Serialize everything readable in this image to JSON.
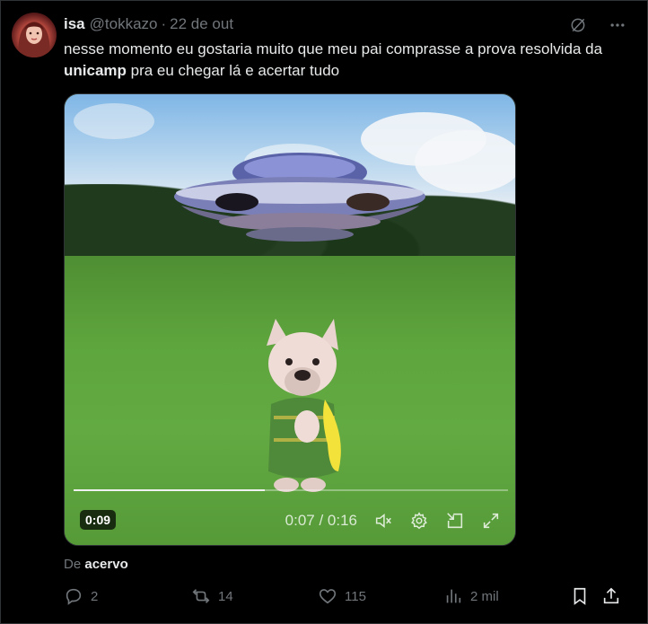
{
  "tweet": {
    "author_name": "isa",
    "handle": "@tokkazo",
    "separator": "·",
    "date": "22 de out",
    "text_before": "nesse momento eu gostaria muito que meu pai comprasse a prova resolvida da ",
    "text_bold": "unicamp",
    "text_after": " pra eu chegar lá e acertar tudo"
  },
  "video": {
    "remaining_badge": "0:09",
    "time_display": "0:07 / 0:16",
    "progress": 0.44
  },
  "source": {
    "prefix": "De",
    "name": "acervo"
  },
  "actions": {
    "replies": "2",
    "retweets": "14",
    "likes": "115",
    "views": "2 mil"
  },
  "icons": {
    "grok": "grok-icon",
    "more": "more-icon",
    "reply": "reply-icon",
    "retweet": "retweet-icon",
    "like": "like-icon",
    "views": "views-icon",
    "bookmark": "bookmark-icon",
    "share": "share-icon"
  }
}
